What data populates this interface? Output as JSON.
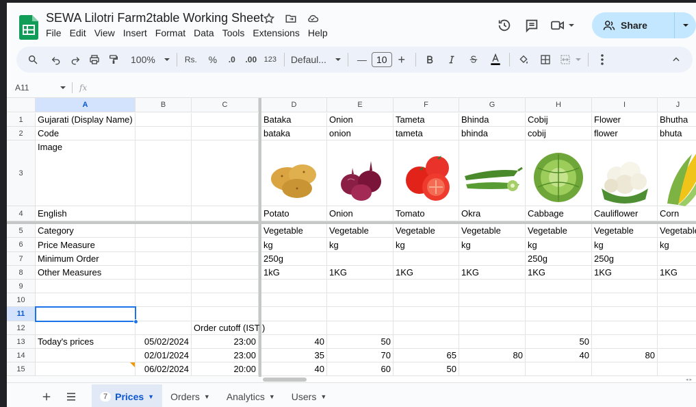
{
  "doc": {
    "title": "SEWA Lilotri Farm2table Working Sheet",
    "menu": [
      "File",
      "Edit",
      "View",
      "Insert",
      "Format",
      "Data",
      "Tools",
      "Extensions",
      "Help"
    ],
    "share_label": "Share"
  },
  "toolbar": {
    "zoom": "100%",
    "currency": "Rs.",
    "percent": "%",
    "dec_decrease": ".0",
    "dec_increase": ".00",
    "number_format": "123",
    "font": "Defaul...",
    "font_size": "10",
    "minus": "—",
    "plus": "+"
  },
  "formula_bar": {
    "name_box": "A11",
    "fx": "fx"
  },
  "columns": [
    "A",
    "B",
    "C",
    "D",
    "E",
    "F",
    "G",
    "H",
    "I",
    "J"
  ],
  "rows": [
    "1",
    "2",
    "3",
    "4",
    "5",
    "6",
    "7",
    "8",
    "9",
    "10",
    "11",
    "12",
    "13",
    "14",
    "15"
  ],
  "labels": {
    "r1": "Gujarati (Display Name)",
    "r2": "Code",
    "r3": "Image",
    "r4": "English",
    "r5": "Category",
    "r6": "Price Measure",
    "r7": "Minimum Order",
    "r8": "Other Measures",
    "r12": "Order cutoff (IST )",
    "r13": "Today's prices"
  },
  "produce": [
    {
      "gujarati": "Bataka",
      "code": "bataka",
      "english": "Potato",
      "category": "Vegetable",
      "measure": "kg",
      "min_order": "250g",
      "other": "1kG",
      "image": "potato-image"
    },
    {
      "gujarati": "Onion",
      "code": "onion",
      "english": "Onion",
      "category": "Vegetable",
      "measure": "kg",
      "min_order": "",
      "other": "1KG",
      "image": "onion-image"
    },
    {
      "gujarati": "Tameta",
      "code": "tameta",
      "english": "Tomato",
      "category": "Vegetable",
      "measure": "kg",
      "min_order": "",
      "other": "1KG",
      "image": "tomato-image"
    },
    {
      "gujarati": "Bhinda",
      "code": "bhinda",
      "english": "Okra",
      "category": "Vegetable",
      "measure": "kg",
      "min_order": "",
      "other": "1KG",
      "image": "okra-image"
    },
    {
      "gujarati": "Cobij",
      "code": "cobij",
      "english": "Cabbage",
      "category": "Vegetable",
      "measure": "kg",
      "min_order": "250g",
      "other": "1KG",
      "image": "cabbage-image"
    },
    {
      "gujarati": "Flower",
      "code": "flower",
      "english": "Cauliflower",
      "category": "Vegetable",
      "measure": "kg",
      "min_order": "250g",
      "other": "1KG",
      "image": "cauliflower-image"
    },
    {
      "gujarati": "Bhutha",
      "code": "bhuta",
      "english": "Corn",
      "category": "Vegetable",
      "measure": "kg",
      "min_order": "",
      "other": "1KG",
      "image": "corn-image"
    }
  ],
  "prices": [
    {
      "date": "05/02/2024",
      "cutoff": "23:00",
      "values": [
        "40",
        "50",
        "",
        "",
        "50",
        "",
        ""
      ]
    },
    {
      "date": "02/01/2024",
      "cutoff": "23:00",
      "values": [
        "35",
        "70",
        "65",
        "80",
        "40",
        "80",
        ""
      ]
    },
    {
      "date": "06/02/2024",
      "cutoff": "20:00",
      "values": [
        "40",
        "60",
        "50",
        "",
        "",
        "",
        ""
      ]
    }
  ],
  "sheets": {
    "active": {
      "label": "Prices",
      "badge": "7"
    },
    "others": [
      "Orders",
      "Analytics",
      "Users"
    ]
  },
  "colors": {
    "accent": "#0b57d0",
    "share": "#c2e7ff",
    "selection": "#1a73e8",
    "sheets_green": "#0f9d58"
  }
}
